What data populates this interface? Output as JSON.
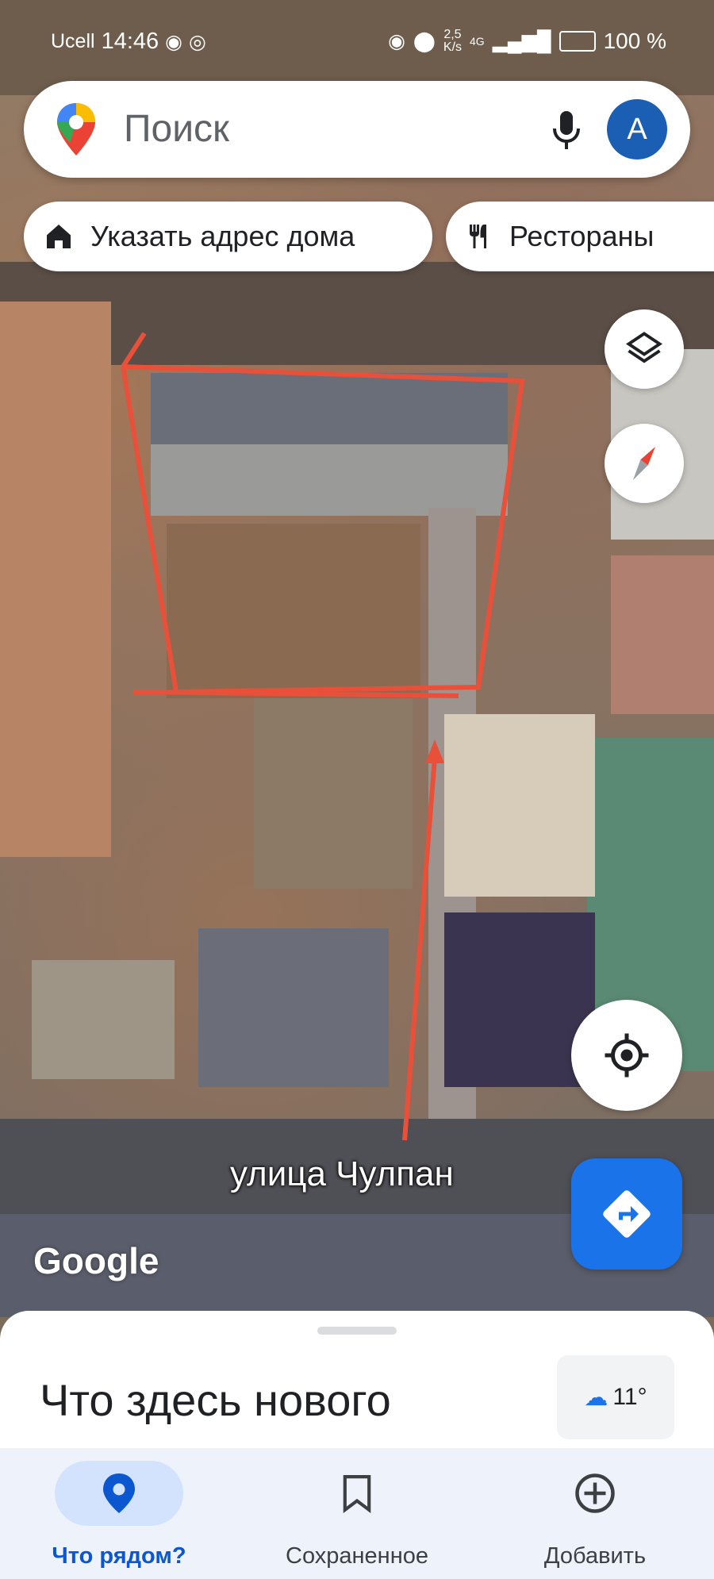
{
  "status_bar": {
    "carrier": "Ucell",
    "time": "14:46",
    "speed": "2,5\nK/s",
    "network": "4G",
    "battery": "100 %"
  },
  "search": {
    "placeholder": "Поиск",
    "avatar_letter": "A"
  },
  "chips": [
    {
      "label": "Указать адрес дома",
      "icon": "home-icon"
    },
    {
      "label": "Рестораны",
      "icon": "restaurant-icon"
    }
  ],
  "map": {
    "street_label": "улица Чулпан",
    "attribution": "Google"
  },
  "sheet": {
    "title": "Что здесь нового",
    "weather_temp": "11°"
  },
  "nav": [
    {
      "label": "Что рядом?",
      "icon": "location-pin-icon",
      "active": true
    },
    {
      "label": "Сохраненное",
      "icon": "bookmark-icon",
      "active": false
    },
    {
      "label": "Добавить",
      "icon": "add-circle-icon",
      "active": false
    }
  ],
  "colors": {
    "accent": "#1a73e8",
    "annotation_red": "#e8503a",
    "avatar_bg": "#1a5fb4"
  }
}
